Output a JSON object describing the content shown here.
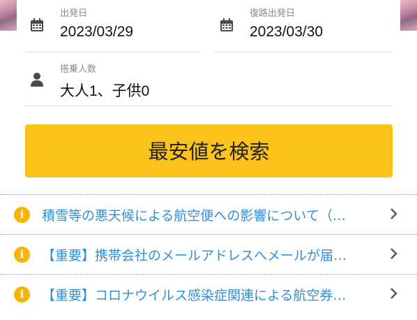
{
  "form": {
    "departure": {
      "label": "出発日",
      "value": "2023/03/29",
      "icon": "calendar-icon"
    },
    "return": {
      "label": "復路出発日",
      "value": "2023/03/30",
      "icon": "calendar-icon"
    },
    "passengers": {
      "label": "搭乗人数",
      "value": "大人1、子供0",
      "icon": "person-icon"
    },
    "search_label": "最安値を検索"
  },
  "notices": [
    {
      "text": "積雪等の悪天候による航空便への影響について（…"
    },
    {
      "text": "【重要】携帯会社のメールアドレスへメールが届…"
    },
    {
      "text": "【重要】コロナウイルス感染症関連による航空券…"
    }
  ],
  "colors": {
    "accent": "#fbc31a",
    "link": "#2e8fd8",
    "info": "#f8b400"
  }
}
